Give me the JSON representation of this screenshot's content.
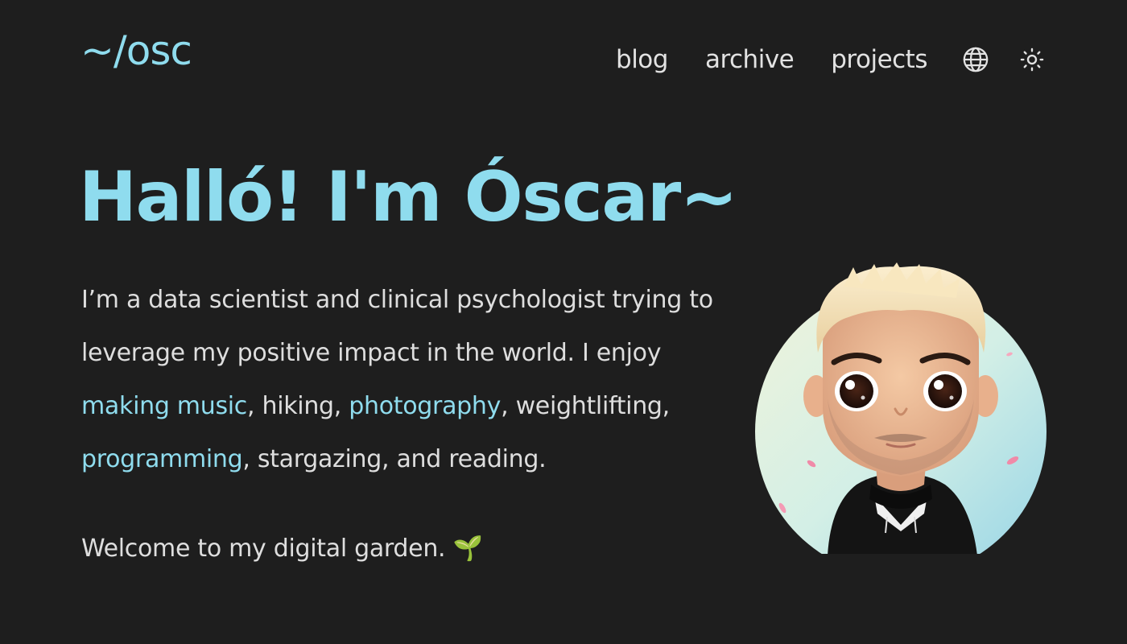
{
  "header": {
    "logo": "~/osc",
    "nav": [
      {
        "label": "blog"
      },
      {
        "label": "archive"
      },
      {
        "label": "projects"
      }
    ],
    "icons": [
      "globe-icon",
      "sun-icon"
    ]
  },
  "hero": {
    "title": "Halló! I'm Óscar~",
    "bio": {
      "t1": "I’m a data scientist and clinical psychologist trying to leverage my positive impact in the world. I enjoy ",
      "link_music": "making music",
      "t2": ", hiking, ",
      "link_photography": "photography",
      "t3": ", weightlifting, ",
      "link_programming": "programming",
      "t4": ", stargazing, and reading."
    },
    "welcome": "Welcome to my digital garden.",
    "welcome_emoji": "🌱"
  },
  "colors": {
    "background": "#1e1e1e",
    "accent": "#8fdcee",
    "text": "#dedede"
  }
}
